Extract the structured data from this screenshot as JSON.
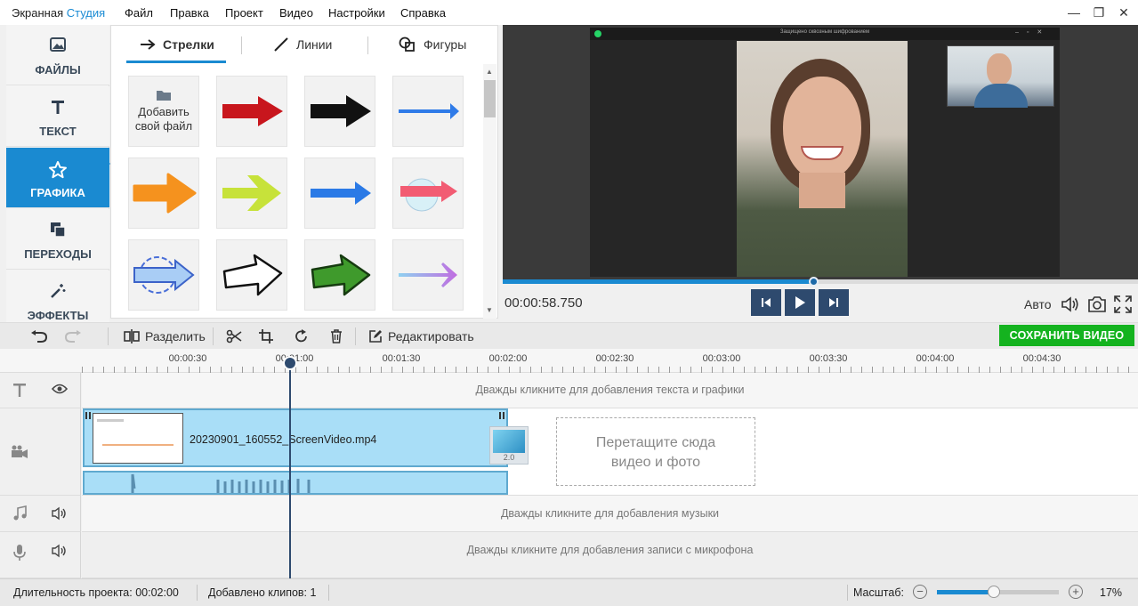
{
  "app": {
    "title_part1": "Экранная ",
    "title_part2": "Студия"
  },
  "menu": [
    "Файл",
    "Правка",
    "Проект",
    "Видео",
    "Настройки",
    "Справка"
  ],
  "window_controls": {
    "minimize": "—",
    "maximize": "❐",
    "close": "✕"
  },
  "sidebar": {
    "items": [
      {
        "label": "ФАЙЛЫ",
        "icon": "image-icon"
      },
      {
        "label": "ТЕКСТ",
        "icon": "text-icon"
      },
      {
        "label": "ГРАФИКА",
        "icon": "star-icon",
        "active": true
      },
      {
        "label": "ПЕРЕХОДЫ",
        "icon": "transitions-icon"
      },
      {
        "label": "ЭФФЕКТЫ",
        "icon": "magic-wand-icon"
      }
    ]
  },
  "library": {
    "tabs": [
      {
        "label": "Стрелки",
        "icon": "arrow-icon",
        "active": true
      },
      {
        "label": "Линии",
        "icon": "line-icon"
      },
      {
        "label": "Фигуры",
        "icon": "shapes-icon"
      }
    ],
    "add_file_label": "Добавить свой файл"
  },
  "preview": {
    "timecode": "00:00:58.750",
    "progress": 0.49,
    "auto_label": "Авто",
    "call_window_title": "Защищено сквозным шифрованием"
  },
  "toolbar": {
    "split_label": "Разделить",
    "edit_label": "Редактировать",
    "save_label": "СОХРАНИТЬ ВИДЕО"
  },
  "ruler": {
    "labels": [
      "00:00:30",
      "00:01:00",
      "00:01:30",
      "00:02:00",
      "00:02:30",
      "00:03:00",
      "00:03:30",
      "00:04:00",
      "00:04:30"
    ]
  },
  "timeline": {
    "text_hint": "Дважды кликните для добавления текста и графики",
    "clip_name": "20230901_160552_ScreenVideo.mp4",
    "transition_value": "2.0",
    "dropzone_line1": "Перетащите сюда",
    "dropzone_line2": "видео и фото",
    "music_hint": "Дважды кликните для добавления музыки",
    "mic_hint": "Дважды кликните для добавления записи с микрофона"
  },
  "status": {
    "duration_label": "Длительность проекта:",
    "duration_value": "00:02:00",
    "clips_label": "Добавлено клипов:",
    "clips_value": "1",
    "zoom_label": "Масштаб:",
    "zoom_value": "17%",
    "zoom_level": 0.47
  },
  "colors": {
    "accent": "#1a8ad1",
    "save_green": "#14b31f",
    "dark_button": "#2e4a6e",
    "clip_fill": "#a9def7"
  }
}
